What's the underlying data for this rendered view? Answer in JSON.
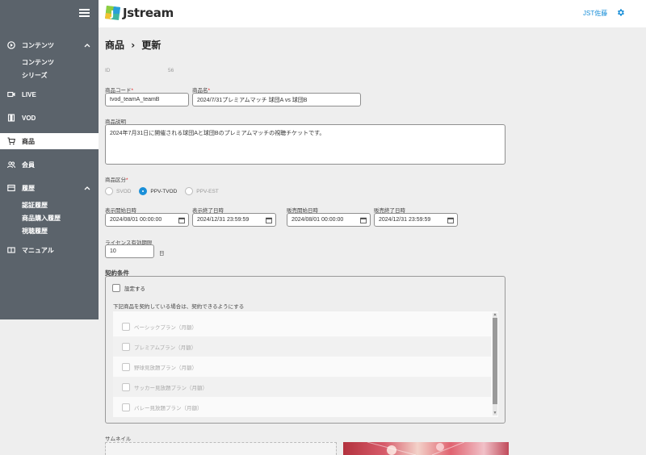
{
  "header": {
    "logo_text": "Jstream",
    "user_name": "JST佐藤"
  },
  "sidebar": {
    "items": [
      {
        "label": "コンテンツ",
        "icon": "play-circle-icon"
      },
      {
        "label": "LIVE",
        "icon": "video-camera-icon"
      },
      {
        "label": "VOD",
        "icon": "film-icon"
      },
      {
        "label": "商品",
        "icon": "cart-icon"
      },
      {
        "label": "会員",
        "icon": "users-icon"
      },
      {
        "label": "履歴",
        "icon": "history-icon"
      },
      {
        "label": "マニュアル",
        "icon": "book-icon"
      }
    ],
    "content_sub": [
      "コンテンツ",
      "シリーズ"
    ],
    "history_sub": [
      "認証履歴",
      "商品購入履歴",
      "視聴履歴"
    ]
  },
  "page": {
    "breadcrumb_parent": "商品",
    "breadcrumb_sep": "›",
    "breadcrumb_current": "更新"
  },
  "form": {
    "id_label": "ID",
    "id_value": "56",
    "code_label": "商品コード",
    "code_value": "tvod_teamA_teamB",
    "name_label": "商品名",
    "name_value": "2024/7/31プレミアムマッチ 球団A vs 球団B",
    "desc_label": "商品説明",
    "desc_value": "2024年7月31日に開催される球団Aと球団Bのプレミアムマッチの視聴チケットです。",
    "type_label": "商品区分",
    "type_options": [
      "SVOD",
      "PPV-TVOD",
      "PPV-EST"
    ],
    "type_selected": "PPV-TVOD",
    "display_start_label": "表示開始日時",
    "display_start_value": "2024/08/01 00:00:00",
    "display_end_label": "表示終了日時",
    "display_end_value": "2024/12/31 23:59:59",
    "sale_start_label": "販売開始日時",
    "sale_start_value": "2024/08/01 00:00:00",
    "sale_end_label": "販売終了日時",
    "sale_end_value": "2024/12/31 23:59:59",
    "license_label": "ライセンス有効期限",
    "license_value": "10",
    "license_unit": "日",
    "contract_title": "契約条件",
    "contract_set_label": "設定する",
    "contract_note": "下記商品を契約している場合は、契約できるようにする",
    "plans": [
      "ベーシックプラン（月額）",
      "プレミアムプラン（月額）",
      "野球見放題プラン（月額）",
      "サッカー見放題プラン（月額）",
      "バレー見放題プラン（月額）"
    ],
    "thumbnail_label": "サムネイル"
  },
  "colors": {
    "sidebar_bg": "#5b636b",
    "accent": "#1a8fd8",
    "required": "#e02020"
  }
}
